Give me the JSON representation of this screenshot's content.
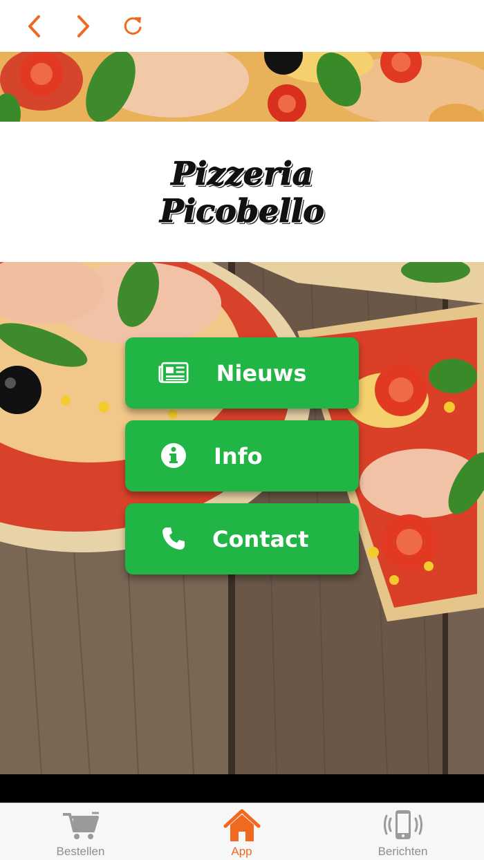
{
  "header": {
    "back_icon": "chevron-left-icon",
    "forward_icon": "chevron-right-icon",
    "reload_icon": "reload-icon",
    "accent_color": "#ef6a1e"
  },
  "logo": {
    "line1": "Pizzeria",
    "line2": "Picobello"
  },
  "menu": {
    "buttons": [
      {
        "label": "Nieuws",
        "icon": "newspaper-icon"
      },
      {
        "label": "Info",
        "icon": "info-icon"
      },
      {
        "label": "Contact",
        "icon": "phone-icon"
      }
    ],
    "button_color": "#20b544"
  },
  "tabbar": {
    "tabs": [
      {
        "label": "Bestellen",
        "icon": "cart-icon",
        "active": false
      },
      {
        "label": "App",
        "icon": "home-icon",
        "active": true
      },
      {
        "label": "Berichten",
        "icon": "phone-vibrate-icon",
        "active": false
      }
    ],
    "active_color": "#ef6a1e",
    "inactive_color": "#8e8e8e"
  }
}
